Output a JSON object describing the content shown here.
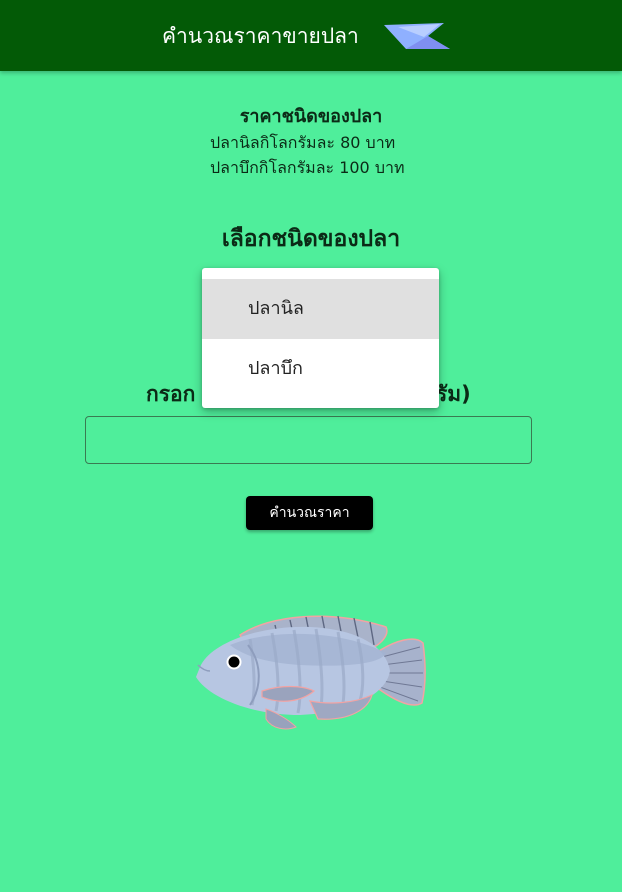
{
  "appbar": {
    "title": "คำนวณราคาขายปลา",
    "logo_icon": "paper-plane-logo"
  },
  "price_info": {
    "title": "ราคาชนิดของปลา",
    "lines": [
      "ปลานิลกิโลกรัมละ 80 บาท",
      "ปลาบึกกิโลกรัมละ 100 บาท"
    ]
  },
  "selector": {
    "title": "เลือกชนิดของปลา",
    "options": [
      "ปลานิล",
      "ปลาบึก"
    ],
    "selected": "ปลานิล"
  },
  "weight": {
    "label_visible_left": "กรอก",
    "label_visible_right": "รัม)",
    "value": ""
  },
  "actions": {
    "calculate_label": "คำนวณราคา"
  },
  "colors": {
    "background": "#4fee9b",
    "appbar": "#035a06",
    "button": "#000000"
  },
  "illustration": "tilapia-fish-image"
}
